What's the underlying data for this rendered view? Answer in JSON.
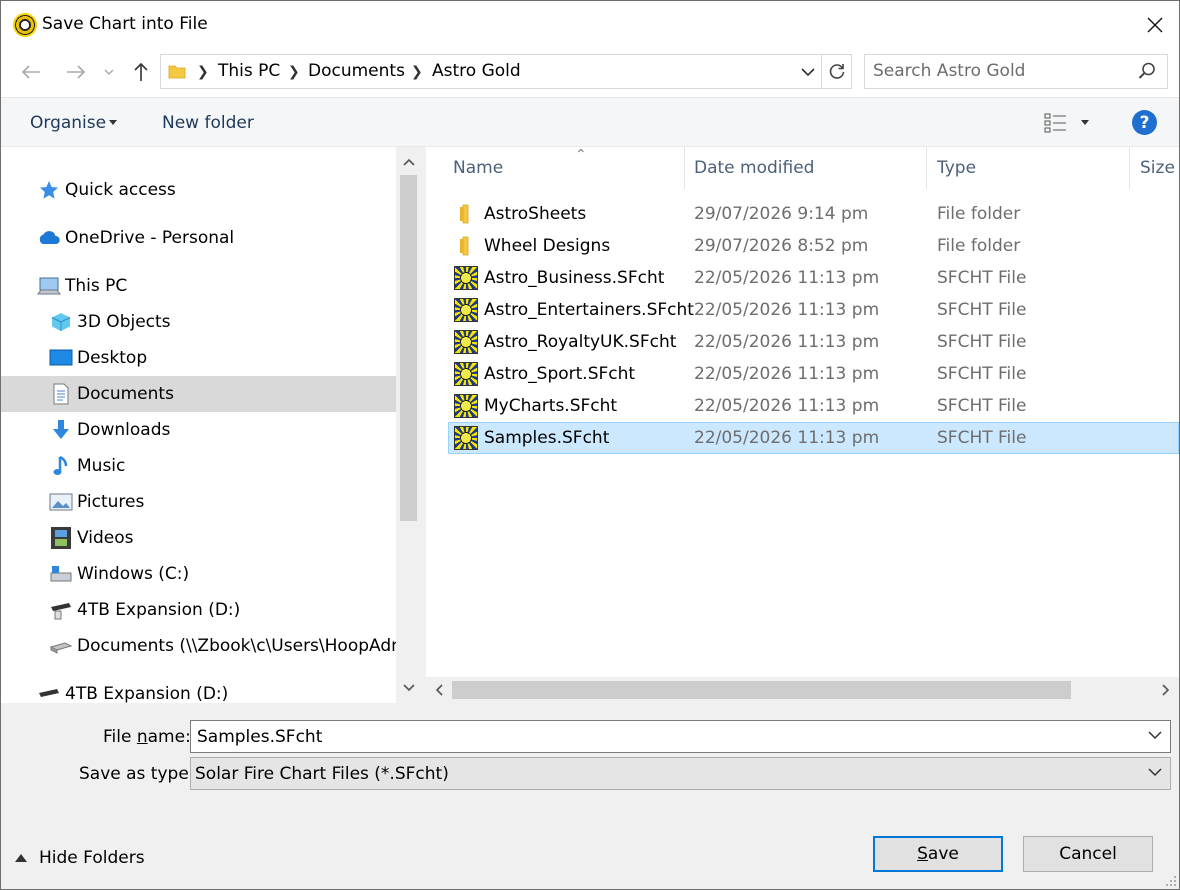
{
  "window": {
    "title": "Save Chart into File"
  },
  "address": {
    "crumbs": [
      "This PC",
      "Documents",
      "Astro Gold"
    ],
    "search_placeholder": "Search Astro Gold"
  },
  "commands": {
    "organise": "Organise",
    "new_folder": "New folder",
    "help": "?"
  },
  "nav": {
    "items": [
      {
        "label": "Quick access",
        "icon": "star-icon"
      },
      {
        "label": "OneDrive - Personal",
        "icon": "cloud-icon"
      },
      {
        "label": "This PC",
        "icon": "computer-icon"
      },
      {
        "label": "3D Objects",
        "icon": "cube-icon"
      },
      {
        "label": "Desktop",
        "icon": "desktop-icon"
      },
      {
        "label": "Documents",
        "icon": "document-icon",
        "selected": true
      },
      {
        "label": "Downloads",
        "icon": "download-arrow-icon"
      },
      {
        "label": "Music",
        "icon": "music-note-icon"
      },
      {
        "label": "Pictures",
        "icon": "picture-icon"
      },
      {
        "label": "Videos",
        "icon": "film-icon"
      },
      {
        "label": "Windows (C:)",
        "icon": "drive-icon"
      },
      {
        "label": "4TB Expansion (D:)",
        "icon": "external-drive-icon"
      },
      {
        "label": "Documents (\\\\Zbook\\c\\Users\\HoopAdm",
        "icon": "network-drive-icon"
      },
      {
        "label": "4TB Expansion (D:)",
        "icon": "external-drive-icon"
      }
    ]
  },
  "files": {
    "columns": [
      "Name",
      "Date modified",
      "Type",
      "Size"
    ],
    "rows": [
      {
        "name": "AstroSheets",
        "date": "29/07/2026 9:14 pm",
        "type": "File folder",
        "kind": "folder"
      },
      {
        "name": "Wheel Designs",
        "date": "29/07/2026 8:52 pm",
        "type": "File folder",
        "kind": "folder"
      },
      {
        "name": "Astro_Business.SFcht",
        "date": "22/05/2026 11:13 pm",
        "type": "SFCHT File",
        "kind": "sfcht"
      },
      {
        "name": "Astro_Entertainers.SFcht",
        "date": "22/05/2026 11:13 pm",
        "type": "SFCHT File",
        "kind": "sfcht"
      },
      {
        "name": "Astro_RoyaltyUK.SFcht",
        "date": "22/05/2026 11:13 pm",
        "type": "SFCHT File",
        "kind": "sfcht"
      },
      {
        "name": "Astro_Sport.SFcht",
        "date": "22/05/2026 11:13 pm",
        "type": "SFCHT File",
        "kind": "sfcht"
      },
      {
        "name": "MyCharts.SFcht",
        "date": "22/05/2026 11:13 pm",
        "type": "SFCHT File",
        "kind": "sfcht"
      },
      {
        "name": "Samples.SFcht",
        "date": "22/05/2026 11:13 pm",
        "type": "SFCHT File",
        "kind": "sfcht",
        "selected": true
      }
    ]
  },
  "form": {
    "file_name_label_pre": "File ",
    "file_name_label_underlined": "n",
    "file_name_label_post": "ame:",
    "file_name_value": "Samples.SFcht",
    "save_type_label": "Save as type:",
    "save_type_value": "Solar Fire Chart Files (*.SFcht)",
    "hide_folders": "Hide Folders",
    "save_underlined": "S",
    "save_rest": "ave",
    "cancel": "Cancel"
  },
  "colors": {
    "accent": "#0078d7",
    "selection": "#cce8ff",
    "help": "#1f6fd0"
  }
}
